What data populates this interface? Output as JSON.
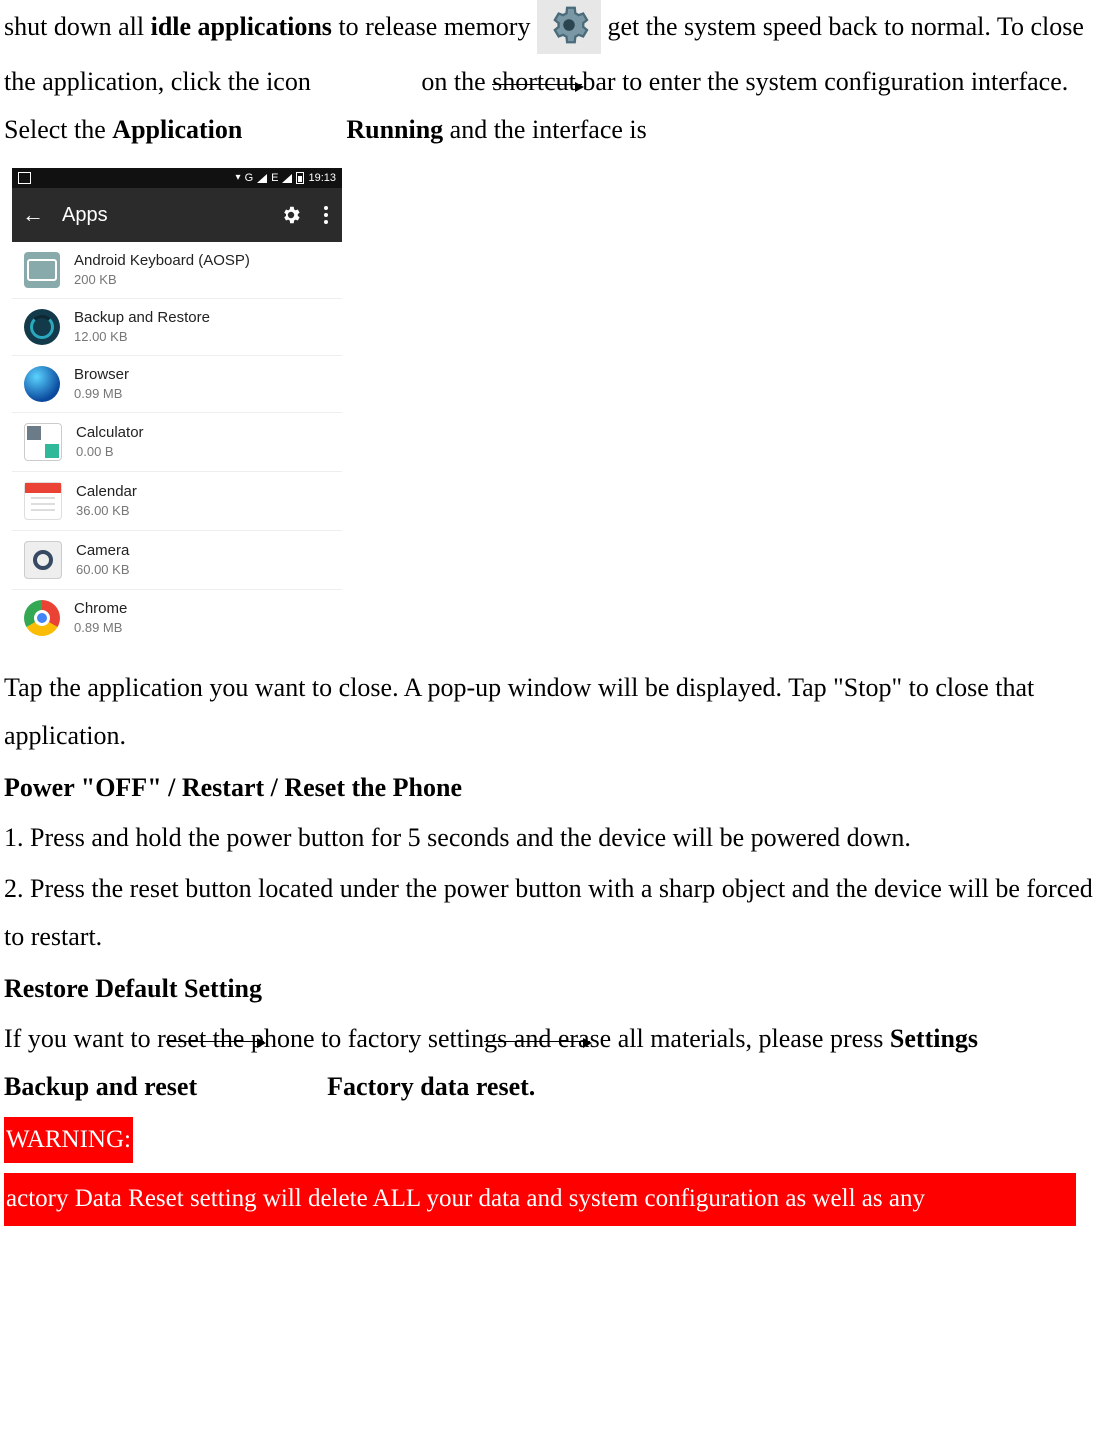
{
  "intro": {
    "part1": "shut down all ",
    "bold1": "idle applications",
    "part2": " to release memory ",
    "part3": " get the system speed back to normal. To close the application, click the icon",
    "part4": "on the ",
    "arrow1_word": "shortcut ",
    "part5": "bar to enter the system configuration interface. Select the ",
    "bold2": "Application",
    "bold3": "Running",
    "part6": " and the interface is"
  },
  "phone": {
    "status_time": "19:13",
    "status_g": "G",
    "status_e": "E",
    "header_title": "Apps",
    "apps": [
      {
        "name": "Android Keyboard (AOSP)",
        "size": "200 KB",
        "iconClass": "ic-keyboard"
      },
      {
        "name": "Backup and Restore",
        "size": "12.00 KB",
        "iconClass": "ic-backup"
      },
      {
        "name": "Browser",
        "size": "0.99 MB",
        "iconClass": "ic-browser"
      },
      {
        "name": "Calculator",
        "size": "0.00 B",
        "iconClass": "ic-calc"
      },
      {
        "name": "Calendar",
        "size": "36.00 KB",
        "iconClass": "ic-cal"
      },
      {
        "name": "Camera",
        "size": "60.00 KB",
        "iconClass": "ic-cam"
      },
      {
        "name": "Chrome",
        "size": "0.89 MB",
        "iconClass": "ic-chrome"
      }
    ]
  },
  "after_phone": "Tap the application you want to close. A pop-up window will be displayed. Tap \"Stop\" to close that application.",
  "section_power_title": "Power \"OFF\" / Restart / Reset the Phone",
  "power_steps": {
    "s1": "1.    Press and hold the power button for 5 seconds and the device will be powered down.",
    "s2": "2. Press the reset button located under the power button with a sharp object and the device will be forced to restart."
  },
  "section_restore_title": "Restore Default Setting",
  "restore": {
    "part1": "If you want to r",
    "arrow2_word": "eset the p",
    "part2": "hone to factory settin",
    "arrow3_word": "gs and era",
    "part3": "se all materials, please press ",
    "bold1": "Settings",
    "bold2": "Backup and reset",
    "bold3": "Factory data reset."
  },
  "warning_label": "WARNING:",
  "warning_body": "actory Data Reset setting will delete ALL your data and system configuration as well as any"
}
